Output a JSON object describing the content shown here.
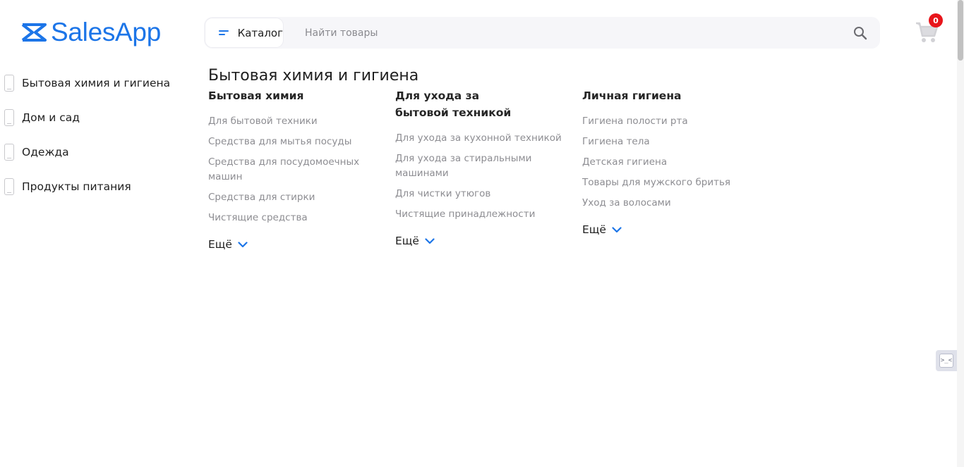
{
  "header": {
    "brand": "SalesApp",
    "brand_color": "#1c75e8",
    "catalog_label": "Каталог",
    "search_placeholder": "Найти товары",
    "cart_count": "0",
    "cart_badge_color": "#e8151b"
  },
  "sidebar": {
    "items": [
      {
        "label": "Бытовая химия и гигиена",
        "icon": "phone-icon"
      },
      {
        "label": "Дом и сад",
        "icon": "phone-icon"
      },
      {
        "label": "Одежда",
        "icon": "phone-icon"
      },
      {
        "label": "Продукты питания",
        "icon": "phone-icon"
      }
    ]
  },
  "main": {
    "title": "Бытовая химия и гигиена",
    "columns": [
      {
        "heading": "Бытовая химия",
        "links": [
          "Для бытовой техники",
          "Средства для мытья посуды",
          "Средства для посудомоечных машин",
          "Средства для стирки",
          "Чистящие средства"
        ],
        "more": "Ещё"
      },
      {
        "heading": "Для ухода за бытовой техникой",
        "links": [
          "Для ухода за кухонной техникой",
          "Для ухода за стиральными машинами",
          "Для чистки утюгов",
          "Чистящие принадлежности"
        ],
        "more": "Ещё"
      },
      {
        "heading": "Личная гигиена",
        "links": [
          "Гигиена полости рта",
          "Гигиена тела",
          "Детская гигиена",
          "Товары для мужского бритья",
          "Уход за волосами"
        ],
        "more": "Ещё"
      }
    ]
  },
  "widget": {
    "glyph": ">_<"
  }
}
